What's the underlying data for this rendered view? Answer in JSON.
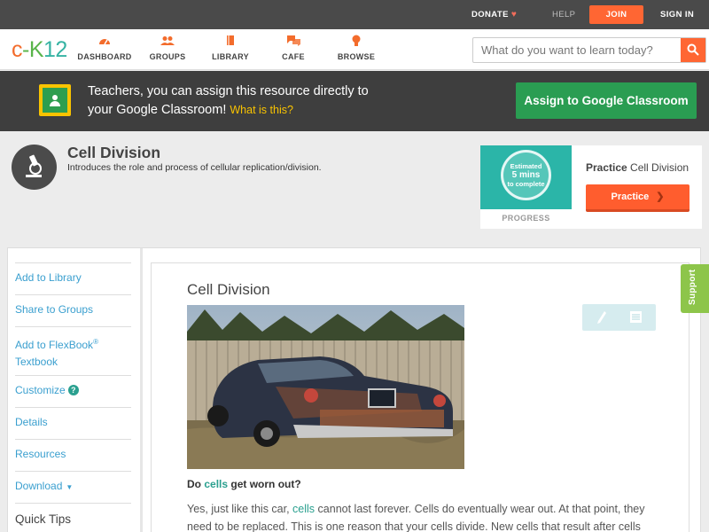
{
  "topbar": {
    "donate": "DONATE",
    "help": "HELP",
    "join": "JOIN",
    "signin": "SIGN IN"
  },
  "logo": {
    "c": "c",
    "k": "K",
    "dash": "-",
    "num": "12"
  },
  "nav": {
    "dashboard": "DASHBOARD",
    "groups": "GROUPS",
    "library": "LIBRARY",
    "cafe": "CAFE",
    "browse": "BROWSE"
  },
  "search": {
    "placeholder": "What do you want to learn today?"
  },
  "classroom": {
    "line1": "Teachers, you can assign this resource directly to",
    "line2": "your Google Classroom!",
    "what_is_this": "What is this?",
    "assign_button": "Assign to Google Classroom"
  },
  "concept": {
    "title": "Cell Division",
    "subtitle": "Introduces the role and process of cellular replication/division."
  },
  "practice": {
    "est_line1": "Estimated",
    "est_line2": "5 mins",
    "est_line3": "to complete",
    "progress_label": "PROGRESS",
    "title_bold": "Practice",
    "title_rest": " Cell Division",
    "button": "Practice"
  },
  "sidebar": {
    "add_library": "Add to Library",
    "share_groups": "Share to Groups",
    "add_flexbook_1": "Add to FlexBook",
    "add_flexbook_reg": "®",
    "add_flexbook_2": "Textbook",
    "customize": "Customize",
    "details": "Details",
    "resources": "Resources",
    "download": "Download",
    "quick_tips": "Quick Tips"
  },
  "article": {
    "title": "Cell Division",
    "q_pre": "Do ",
    "q_link": "cells",
    "q_post": " get worn out?",
    "p1_pre": "Yes, just like this car, ",
    "p1_link": "cells",
    "p1_post": " cannot last forever. Cells do eventually wear out. At that point, they need to be replaced. This is one reason that your cells divide. New cells that result after cells"
  },
  "support": "Support",
  "colors": {
    "accent_orange": "#ff6633",
    "classroom_green": "#2a9d52",
    "teal": "#2aa08f",
    "link_blue": "#3a9fcf"
  }
}
